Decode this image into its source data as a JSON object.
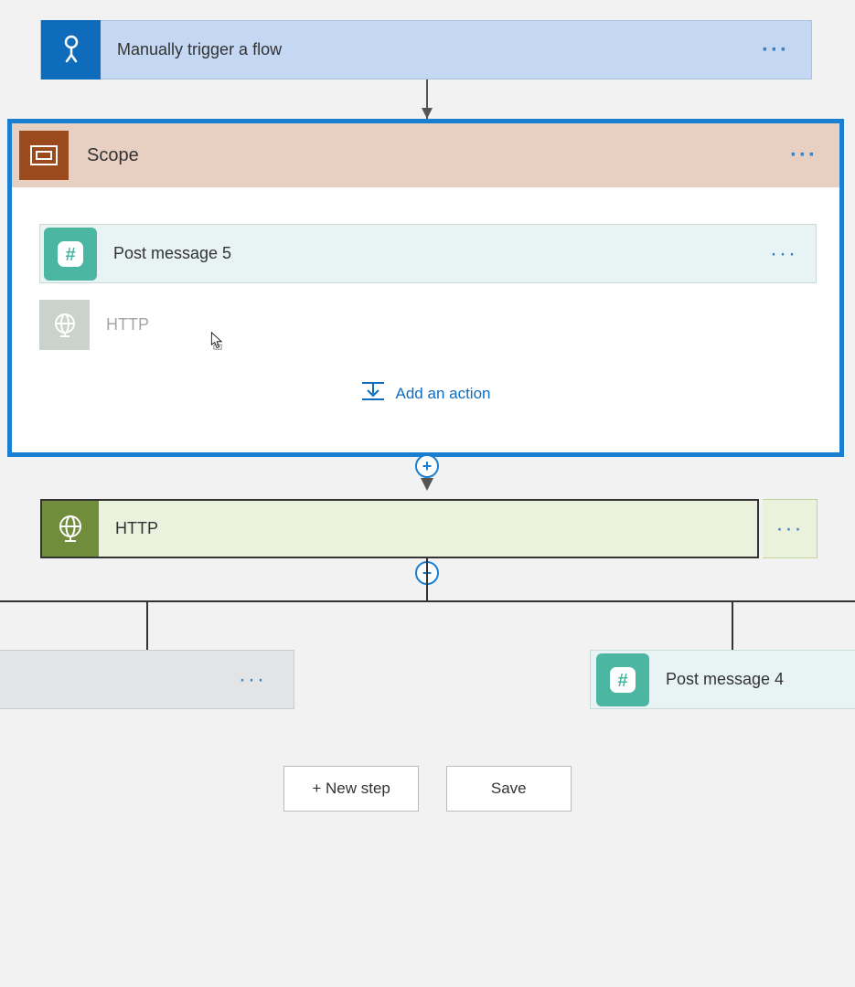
{
  "trigger": {
    "title": "Manually trigger a flow"
  },
  "scope": {
    "title": "Scope",
    "postMessage": "Post message 5",
    "httpGhost": "HTTP",
    "addAction": "Add an action"
  },
  "http": {
    "title": "HTTP"
  },
  "branches": {
    "leftTitle": "",
    "rightTitle": "Post message 4"
  },
  "footer": {
    "newStep": "+ New step",
    "save": "Save"
  }
}
